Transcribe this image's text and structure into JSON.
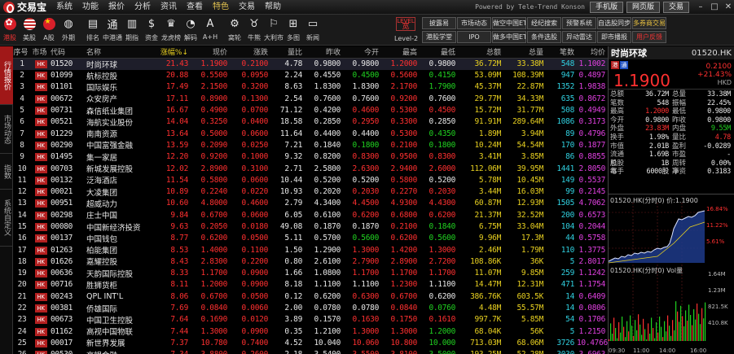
{
  "app": {
    "logo_text": "交易宝",
    "menus": [
      "系统",
      "功能",
      "报价",
      "分析",
      "资讯",
      "查看",
      "特色",
      "交易",
      "帮助"
    ],
    "powered": "Powered by Tele-Trend Konson",
    "buttons": [
      "手机版",
      "网页版",
      "交易"
    ],
    "colors": {
      "up": "#ff3030",
      "down": "#20d020",
      "accent": "#b42020"
    }
  },
  "toolbar": {
    "items": [
      {
        "label": "港股",
        "icon": "hk-flag-icon"
      },
      {
        "label": "美股",
        "icon": "us-flag-icon"
      },
      {
        "label": "A股",
        "icon": "cn-flag-icon"
      },
      {
        "label": "外期",
        "icon": "globe-icon"
      },
      {
        "label": "排名",
        "icon": "bars-icon"
      },
      {
        "label": "中港通",
        "icon": "tong-icon",
        "glyph": "通"
      },
      {
        "label": "期指",
        "icon": "futures-icon"
      },
      {
        "label": "资金",
        "icon": "money-icon"
      },
      {
        "label": "龙虎榜",
        "icon": "trophy-icon"
      },
      {
        "label": "解码",
        "icon": "decode-icon"
      },
      {
        "label": "A+H",
        "icon": "ah-icon",
        "glyph": "A"
      },
      {
        "label": "窝轮",
        "icon": "warrant-icon"
      },
      {
        "label": "牛熊",
        "icon": "bull-bear-icon"
      },
      {
        "label": "大利市",
        "icon": "fortune-icon"
      },
      {
        "label": "多图",
        "icon": "multi-chart-icon"
      },
      {
        "label": "新闻",
        "icon": "news-icon"
      }
    ],
    "level2": {
      "top": "LEVEL",
      "main": "宽",
      "label": "Level-2"
    },
    "grid_buttons": [
      "披露易",
      "市场动态",
      "做空中国ETF",
      "经纪搜索",
      "预警系统",
      "自选股同步",
      "多券商交易",
      "",
      "港股学堂",
      "IPO",
      "做多中国ETF",
      "条件选股",
      "异动雷达",
      "即市播报",
      "用户反馈",
      ""
    ]
  },
  "left_tabs": [
    "行情报价",
    "市场动态",
    "指数",
    "系统自定义"
  ],
  "table": {
    "headers": [
      "序号",
      "市场",
      "代码",
      "名称",
      "涨幅%↓",
      "现价",
      "涨跌",
      "量比",
      "昨收",
      "今开",
      "最高",
      "最低",
      "总额",
      "总量",
      "笔数",
      "均价"
    ],
    "rows": [
      {
        "idx": "1",
        "mkt": "HK",
        "code": "01520",
        "name": "时尚环球",
        "pct": "21.43",
        "price": "1.1900",
        "chg": "0.2100",
        "vr": "4.78",
        "prev": "0.9800",
        "open": "0.9800",
        "high": "1.2000",
        "low": "0.9800",
        "amt": "36.72M",
        "vol": "33.38M",
        "trades": "548",
        "avg": "1.1002"
      },
      {
        "idx": "2",
        "mkt": "HK",
        "code": "01099",
        "name": "航标控股",
        "pct": "20.88",
        "price": "0.5500",
        "chg": "0.0950",
        "vr": "2.24",
        "prev": "0.4550",
        "open": "0.4500",
        "high": "0.5600",
        "low": "0.4150",
        "amt": "53.09M",
        "vol": "108.39M",
        "trades": "947",
        "avg": "0.4897"
      },
      {
        "idx": "3",
        "mkt": "HK",
        "code": "01101",
        "name": "国际娱乐",
        "pct": "17.49",
        "price": "2.1500",
        "chg": "0.3200",
        "vr": "8.63",
        "prev": "1.8300",
        "open": "1.8300",
        "high": "2.1700",
        "low": "1.7900",
        "amt": "45.37M",
        "vol": "22.87M",
        "trades": "1352",
        "avg": "1.9838"
      },
      {
        "idx": "4",
        "mkt": "HK",
        "code": "00672",
        "name": "众安房产",
        "pct": "17.11",
        "price": "0.8900",
        "chg": "0.1300",
        "vr": "2.54",
        "prev": "0.7600",
        "open": "0.7600",
        "high": "0.9200",
        "low": "0.7600",
        "amt": "29.77M",
        "vol": "34.33M",
        "trades": "635",
        "avg": "0.8672"
      },
      {
        "idx": "5",
        "mkt": "HK",
        "code": "00731",
        "name": "森信纸业集团",
        "pct": "16.67",
        "price": "0.4900",
        "chg": "0.0700",
        "vr": "71.12",
        "prev": "0.4200",
        "open": "0.4600",
        "high": "0.5300",
        "low": "0.4500",
        "amt": "15.72M",
        "vol": "31.77M",
        "trades": "508",
        "avg": "0.4949"
      },
      {
        "idx": "6",
        "mkt": "HK",
        "code": "00521",
        "name": "海航实业股份",
        "pct": "14.04",
        "price": "0.3250",
        "chg": "0.0400",
        "vr": "18.58",
        "prev": "0.2850",
        "open": "0.2950",
        "high": "0.3300",
        "low": "0.2850",
        "amt": "91.91M",
        "vol": "289.64M",
        "trades": "1086",
        "avg": "0.3173"
      },
      {
        "idx": "7",
        "mkt": "HK",
        "code": "01229",
        "name": "南南资源",
        "pct": "13.64",
        "price": "0.5000",
        "chg": "0.0600",
        "vr": "11.64",
        "prev": "0.4400",
        "open": "0.4400",
        "high": "0.5300",
        "low": "0.4350",
        "amt": "1.89M",
        "vol": "3.94M",
        "trades": "89",
        "avg": "0.4796"
      },
      {
        "idx": "8",
        "mkt": "HK",
        "code": "00290",
        "name": "中国富强金融",
        "pct": "13.59",
        "price": "0.2090",
        "chg": "0.0250",
        "vr": "7.21",
        "prev": "0.1840",
        "open": "0.1800",
        "high": "0.2100",
        "low": "0.1800",
        "amt": "10.24M",
        "vol": "54.54M",
        "trades": "170",
        "avg": "0.1877"
      },
      {
        "idx": "9",
        "mkt": "HK",
        "code": "01495",
        "name": "集一家居",
        "pct": "12.20",
        "price": "0.9200",
        "chg": "0.1000",
        "vr": "9.32",
        "prev": "0.8200",
        "open": "0.8300",
        "high": "0.9500",
        "low": "0.8300",
        "amt": "3.41M",
        "vol": "3.85M",
        "trades": "86",
        "avg": "0.8855"
      },
      {
        "idx": "10",
        "mkt": "HK",
        "code": "00703",
        "name": "新城发展控股",
        "pct": "12.02",
        "price": "2.8900",
        "chg": "0.3100",
        "vr": "2.71",
        "prev": "2.5800",
        "open": "2.6300",
        "high": "2.9400",
        "low": "2.6000",
        "amt": "112.06M",
        "vol": "39.95M",
        "trades": "1441",
        "avg": "2.8050"
      },
      {
        "idx": "11",
        "mkt": "HK",
        "code": "00132",
        "name": "泛海酒店",
        "pct": "11.54",
        "price": "0.5800",
        "chg": "0.0600",
        "vr": "10.44",
        "prev": "0.5200",
        "open": "0.5200",
        "high": "0.5800",
        "low": "0.5200",
        "amt": "5.78M",
        "vol": "10.45M",
        "trades": "149",
        "avg": "0.5537"
      },
      {
        "idx": "12",
        "mkt": "HK",
        "code": "00021",
        "name": "大凌集团",
        "pct": "10.89",
        "price": "0.2240",
        "chg": "0.0220",
        "vr": "10.93",
        "prev": "0.2020",
        "open": "0.2030",
        "high": "0.2270",
        "low": "0.2030",
        "amt": "3.44M",
        "vol": "16.03M",
        "trades": "99",
        "avg": "0.2145"
      },
      {
        "idx": "13",
        "mkt": "HK",
        "code": "00951",
        "name": "超威动力",
        "pct": "10.60",
        "price": "4.8000",
        "chg": "0.4600",
        "vr": "2.79",
        "prev": "4.3400",
        "open": "4.4500",
        "high": "4.9300",
        "low": "4.4300",
        "amt": "60.87M",
        "vol": "12.93M",
        "trades": "1505",
        "avg": "4.7062"
      },
      {
        "idx": "14",
        "mkt": "HK",
        "code": "00298",
        "name": "庄士中国",
        "pct": "9.84",
        "price": "0.6700",
        "chg": "0.0600",
        "vr": "6.05",
        "prev": "0.6100",
        "open": "0.6200",
        "high": "0.6800",
        "low": "0.6200",
        "amt": "21.37M",
        "vol": "32.52M",
        "trades": "200",
        "avg": "0.6573"
      },
      {
        "idx": "15",
        "mkt": "HK",
        "code": "00080",
        "name": "中国新经济投资",
        "pct": "9.63",
        "price": "0.2050",
        "chg": "0.0180",
        "vr": "49.08",
        "prev": "0.1870",
        "open": "0.1870",
        "high": "0.2100",
        "low": "0.1840",
        "amt": "6.75M",
        "vol": "33.04M",
        "trades": "104",
        "avg": "0.2044"
      },
      {
        "idx": "16",
        "mkt": "HK",
        "code": "00137",
        "name": "中国钱包",
        "pct": "8.77",
        "price": "0.6200",
        "chg": "0.0500",
        "vr": "5.11",
        "prev": "0.5700",
        "open": "0.5600",
        "high": "0.6200",
        "low": "0.5600",
        "amt": "9.96M",
        "vol": "17.3M",
        "trades": "44",
        "avg": "0.5758"
      },
      {
        "idx": "17",
        "mkt": "HK",
        "code": "01263",
        "name": "柏能集团",
        "pct": "8.53",
        "price": "1.4000",
        "chg": "0.1100",
        "vr": "1.50",
        "prev": "1.2900",
        "open": "1.3000",
        "high": "1.4200",
        "low": "1.3000",
        "amt": "2.46M",
        "vol": "1.79M",
        "trades": "110",
        "avg": "1.3775"
      },
      {
        "idx": "18",
        "mkt": "HK",
        "code": "01626",
        "name": "嘉耀控股",
        "pct": "8.43",
        "price": "2.8300",
        "chg": "0.2200",
        "vr": "0.80",
        "prev": "2.6100",
        "open": "2.7900",
        "high": "2.8900",
        "low": "2.7200",
        "amt": "108.86K",
        "vol": "36K",
        "trades": "5",
        "avg": "2.8017"
      },
      {
        "idx": "19",
        "mkt": "HK",
        "code": "00636",
        "name": "天韵国际控股",
        "pct": "8.33",
        "price": "1.1700",
        "chg": "0.0900",
        "vr": "1.66",
        "prev": "1.0800",
        "open": "1.1700",
        "high": "1.1700",
        "low": "1.1700",
        "amt": "11.07M",
        "vol": "9.85M",
        "trades": "259",
        "avg": "1.1242"
      },
      {
        "idx": "20",
        "mkt": "HK",
        "code": "00716",
        "name": "胜狮货柜",
        "pct": "8.11",
        "price": "1.2000",
        "chg": "0.0900",
        "vr": "8.18",
        "prev": "1.1100",
        "open": "1.1100",
        "high": "1.2300",
        "low": "1.1100",
        "amt": "14.47M",
        "vol": "12.31M",
        "trades": "471",
        "avg": "1.1754"
      },
      {
        "idx": "21",
        "mkt": "HK",
        "code": "00243",
        "name": "QPL INT'L",
        "pct": "8.06",
        "price": "0.6700",
        "chg": "0.0500",
        "vr": "0.12",
        "prev": "0.6200",
        "open": "0.6300",
        "high": "0.6700",
        "low": "0.6200",
        "amt": "386.76K",
        "vol": "603.5K",
        "trades": "14",
        "avg": "0.6409"
      },
      {
        "idx": "22",
        "mkt": "HK",
        "code": "00381",
        "name": "侨雄国际",
        "pct": "7.69",
        "price": "0.0840",
        "chg": "0.0060",
        "vr": "2.00",
        "prev": "0.0780",
        "open": "0.0780",
        "high": "0.0840",
        "low": "0.0760",
        "amt": "4.48M",
        "vol": "55.57M",
        "trades": "14",
        "avg": "0.0806"
      },
      {
        "idx": "23",
        "mkt": "HK",
        "code": "00673",
        "name": "中国卫生控股",
        "pct": "7.64",
        "price": "0.1690",
        "chg": "0.0120",
        "vr": "3.89",
        "prev": "0.1570",
        "open": "0.1630",
        "high": "0.1750",
        "low": "0.1610",
        "amt": "997.7K",
        "vol": "5.85M",
        "trades": "54",
        "avg": "0.1706"
      },
      {
        "idx": "24",
        "mkt": "HK",
        "code": "01162",
        "name": "高视中国物联",
        "pct": "7.44",
        "price": "1.3000",
        "chg": "0.0900",
        "vr": "0.35",
        "prev": "1.2100",
        "open": "1.3000",
        "high": "1.3000",
        "low": "1.2000",
        "amt": "68.04K",
        "vol": "56K",
        "trades": "5",
        "avg": "1.2150"
      },
      {
        "idx": "25",
        "mkt": "HK",
        "code": "00017",
        "name": "新世界发展",
        "pct": "7.37",
        "price": "10.780",
        "chg": "0.7400",
        "vr": "4.52",
        "prev": "10.040",
        "open": "10.060",
        "high": "10.800",
        "low": "10.000",
        "amt": "713.03M",
        "vol": "68.06M",
        "trades": "3726",
        "avg": "10.4766"
      },
      {
        "idx": "26",
        "mkt": "HK",
        "code": "00530",
        "name": "高银金融",
        "pct": "7.34",
        "price": "3.8800",
        "chg": "0.2600",
        "vr": "2.18",
        "prev": "3.5400",
        "open": "3.5500",
        "high": "3.8100",
        "low": "3.5000",
        "amt": "193.25M",
        "vol": "52.28M",
        "trades": "3030",
        "avg": "3.6963"
      }
    ]
  },
  "detail": {
    "name": "时尚环球",
    "code": "01520.HK",
    "price": "1.1900",
    "change": "0.2100",
    "pct": "+21.43%",
    "currency": "HKD",
    "badges": [
      "港",
      "通"
    ],
    "stats": [
      {
        "k": "总额",
        "v": "36.72M",
        "k2": "总量",
        "v2": "33.38M"
      },
      {
        "k": "笔数",
        "v": "548",
        "k2": "振幅",
        "v2": "22.45%"
      },
      {
        "k": "最高",
        "v": "1.2000",
        "k2": "最低",
        "v2": "0.9800"
      },
      {
        "k": "今开",
        "v": "0.9800",
        "k2": "昨收",
        "v2": "0.9800"
      },
      {
        "k": "外盘",
        "v": "23.83M",
        "k2": "内盘",
        "v2": "9.55M"
      },
      {
        "k": "换手",
        "v": "1.98%",
        "k2": "量比",
        "v2": "4.78"
      },
      {
        "k": "市值",
        "v": "2.01B",
        "k2": "盈利",
        "v2": "-0.0289"
      },
      {
        "k": "流通股",
        "v": "1.69B",
        "k2": "市盈",
        "v2": "-"
      },
      {
        "k": "总股本",
        "v": "1B",
        "k2": "周转率",
        "v2": "0.00%"
      },
      {
        "k": "每手",
        "v": "6000股",
        "k2": "净资",
        "v2": "0.3183"
      }
    ],
    "chart": {
      "title": "01520.HK(分时0) 价:1.1900",
      "vol_title": "01520.HK(分时0) Vol量",
      "price_labels": [
        "16.84%",
        "11.22%",
        "5.61%"
      ],
      "vol_labels": [
        "1.64M",
        "1.23M",
        "821.5K",
        "410.8K"
      ],
      "time_labels": [
        "09:30",
        "11:00",
        "14:00",
        "16:00"
      ]
    }
  }
}
